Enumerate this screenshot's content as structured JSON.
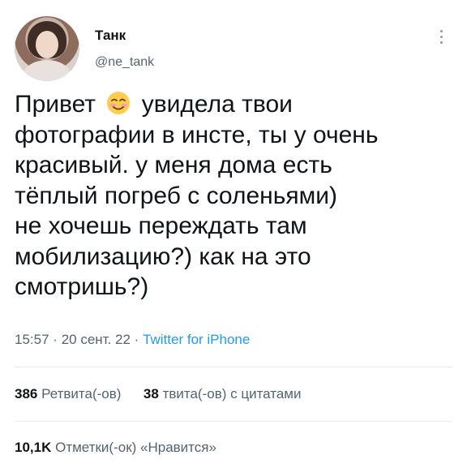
{
  "author": {
    "display_name": "Танк",
    "username": "@ne_tank"
  },
  "tweet": {
    "lines": [
      {
        "before_emoji": "Привет",
        "emoji": "smiling-blushing-face-emoji",
        "after_emoji": "увидела твои"
      },
      "фотографии в инсте, ты у очень",
      "красивый. у меня дома есть",
      "тёплый погреб с соленьями)",
      "не хочешь переждать там",
      "мобилизацию?) как на это",
      "смотришь?)"
    ],
    "time": "15:57",
    "date": "20 сент. 22",
    "separator": "·",
    "source": "Twitter for iPhone"
  },
  "stats": {
    "retweets_count": "386",
    "retweets_label": "Ретвита(-ов)",
    "quotes_count": "38",
    "quotes_label": "твита(-ов) с цитатами",
    "likes_count": "10,1K",
    "likes_label": "Отметки(-ок) «Нравится»"
  },
  "colors": {
    "text": "#0f1419",
    "secondary": "#536471",
    "link": "#1d9bf0",
    "divider": "#e6ecf0"
  }
}
